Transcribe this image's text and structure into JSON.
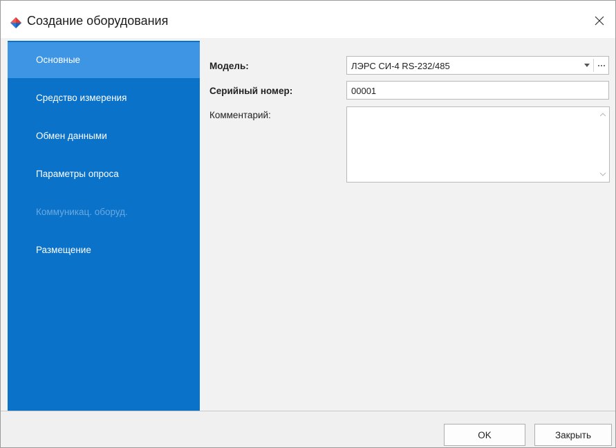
{
  "window": {
    "title": "Создание оборудования",
    "icon": "app-logo-icon",
    "close_icon": "close-icon"
  },
  "sidebar": {
    "items": [
      {
        "label": "Основные",
        "state": "active"
      },
      {
        "label": "Средство измерения",
        "state": "normal"
      },
      {
        "label": "Обмен данными",
        "state": "normal"
      },
      {
        "label": "Параметры опроса",
        "state": "normal"
      },
      {
        "label": "Коммуникац. оборуд.",
        "state": "disabled"
      },
      {
        "label": "Размещение",
        "state": "normal"
      }
    ]
  },
  "form": {
    "model_label": "Модель:",
    "model_value": "ЛЭРС СИ-4 RS-232/485",
    "serial_label": "Серийный номер:",
    "serial_value": "00001",
    "comment_label": "Комментарий:",
    "comment_value": ""
  },
  "buttons": {
    "ok": "OK",
    "close": "Закрыть"
  },
  "colors": {
    "sidebar": "#0a72c9",
    "sidebar_active": "#3d95e3",
    "sidebar_disabled_text": "#6aa9e0"
  }
}
